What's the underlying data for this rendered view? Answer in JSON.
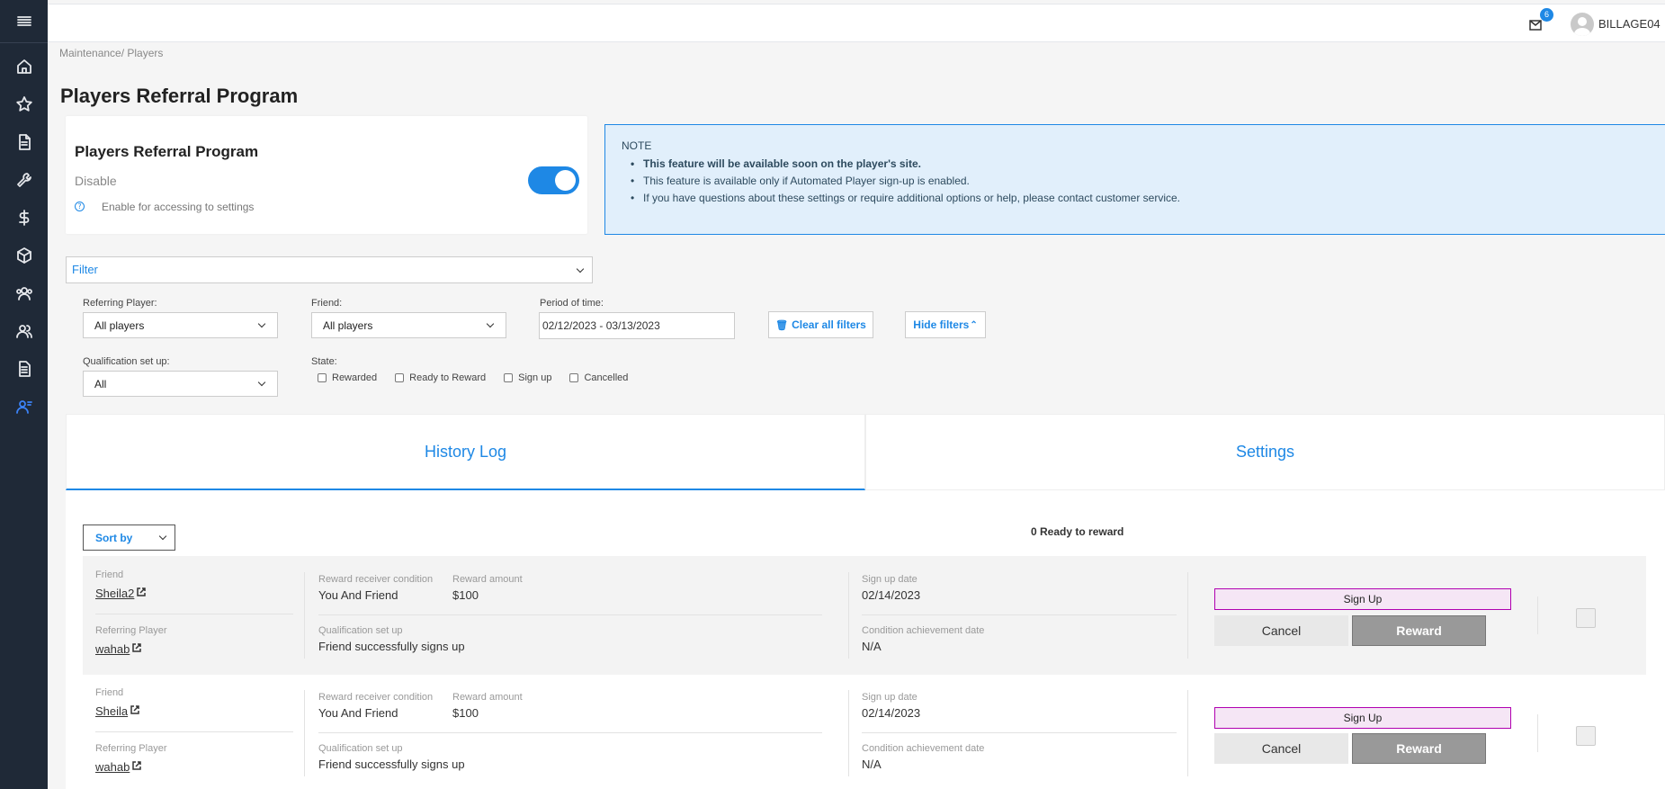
{
  "topbar": {
    "notification_count": "6",
    "username": "BILLAGE04"
  },
  "sidebar": {
    "items": [
      "menu-icon",
      "home-icon",
      "star-icon",
      "document-icon",
      "wrench-icon",
      "dollar-icon",
      "package-icon",
      "group-icon",
      "users-icon",
      "report-icon",
      "referral-icon"
    ]
  },
  "breadcrumb": "Maintenance/ Players",
  "page_title": "Players Referral Program",
  "program_card": {
    "title": "Players Referral Program",
    "state": "Disable",
    "help_text": "Enable for accessing to settings",
    "toggle_on": true
  },
  "note": {
    "label": "NOTE",
    "items": [
      "This feature will be available soon on the player's site.",
      "This feature is available only if Automated Player sign-up is enabled.",
      "If you have questions about these settings or require additional options or help, please contact customer service."
    ]
  },
  "filter": {
    "label": "Filter",
    "referring_player_label": "Referring Player:",
    "referring_player_value": "All players",
    "friend_label": "Friend:",
    "friend_value": "All players",
    "period_label": "Period of time:",
    "period_value": "02/12/2023 - 03/13/2023",
    "clear_label": "Clear all filters",
    "hide_label": "Hide filters",
    "qualification_label": "Qualification set up:",
    "qualification_value": "All",
    "state_label": "State:",
    "states": [
      "Rewarded",
      "Ready to Reward",
      "Sign up",
      "Cancelled"
    ]
  },
  "tabs": {
    "history": "History Log",
    "settings": "Settings"
  },
  "results": {
    "sort_label": "Sort by",
    "ready_count": "0 Ready to reward",
    "labels": {
      "friend": "Friend",
      "referring_player": "Referring Player",
      "reward_receiver": "Reward receiver condition",
      "reward_amount": "Reward amount",
      "qualification": "Qualification set up",
      "sign_up_date": "Sign up date",
      "condition_date": "Condition achievement date",
      "cancel": "Cancel",
      "reward": "Reward"
    },
    "rows": [
      {
        "friend": "Sheila2",
        "referring_player": "wahab",
        "reward_receiver": "You And Friend",
        "reward_amount": "$100",
        "qualification": "Friend successfully signs up",
        "sign_up_date": "02/14/2023",
        "condition_date": "N/A",
        "status": "Sign Up"
      },
      {
        "friend": "Sheila",
        "referring_player": "wahab",
        "reward_receiver": "You And Friend",
        "reward_amount": "$100",
        "qualification": "Friend successfully signs up",
        "sign_up_date": "02/14/2023",
        "condition_date": "N/A",
        "status": "Sign Up"
      }
    ]
  },
  "colors": {
    "sidebar": "#1f2937",
    "accent": "#1e88e5",
    "note_bg": "#e1effb",
    "status_border": "#b000b0"
  }
}
